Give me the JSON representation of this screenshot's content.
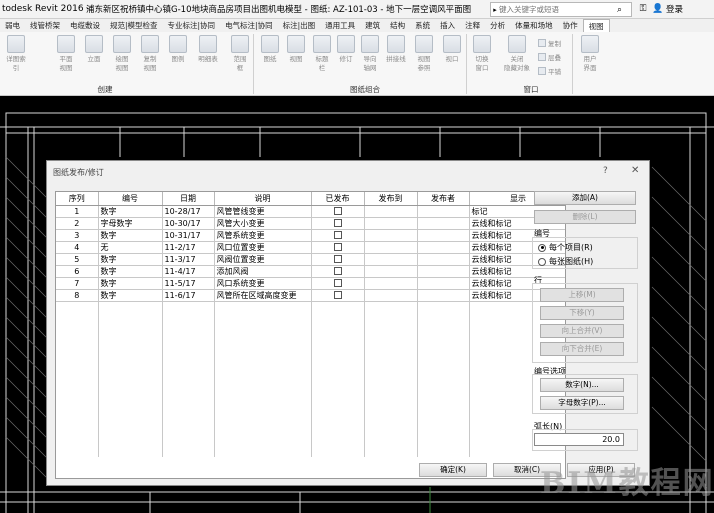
{
  "titlebar": {
    "app_name": "todesk Revit 2016 -",
    "document": "浦东新区祝桥镇中心镇G-10地块商品房项目出图机电模型 - 图纸: AZ-101-03 - 地下一层空调风平面图",
    "search_placeholder": "键入关键字或短语",
    "login_label": "登录"
  },
  "ribbon_tabs": [
    {
      "label": "弱电",
      "active": false
    },
    {
      "label": "线管桥架",
      "active": false
    },
    {
      "label": "电缆敷设",
      "active": false
    },
    {
      "label": "规范|模型检查",
      "active": false
    },
    {
      "label": "专业标注|协同",
      "active": false
    },
    {
      "label": "电气标注|协同",
      "active": false
    },
    {
      "label": "标注|出图",
      "active": false
    },
    {
      "label": "通用工具",
      "active": false
    },
    {
      "label": "建筑",
      "active": false
    },
    {
      "label": "结构",
      "active": false
    },
    {
      "label": "系统",
      "active": false
    },
    {
      "label": "插入",
      "active": false
    },
    {
      "label": "注释",
      "active": false
    },
    {
      "label": "分析",
      "active": false
    },
    {
      "label": "体量和场地",
      "active": false
    },
    {
      "label": "协作",
      "active": false
    },
    {
      "label": "视图",
      "active": true
    }
  ],
  "ribbon": {
    "panel_create": "创建",
    "panel_sheet": "图纸组合",
    "panel_window": "窗口",
    "buttons": [
      "详图索引",
      "平面\n视图",
      "立面",
      "绘图\n视图",
      "复制\n视图",
      "图例",
      "明细表",
      "范围\n框",
      "图纸",
      "视图",
      "标题\n栏",
      "修订",
      "导向\n轴网",
      "拼接线",
      "视图\n参照",
      "视口",
      "切换\n窗口",
      "关闭\n隐藏对象",
      "用户\n界面"
    ],
    "small_buttons": [
      "复制",
      "层叠",
      "平铺"
    ]
  },
  "dialog": {
    "title": "图纸发布/修订",
    "help": "?",
    "close": "✕",
    "columns": [
      "序列",
      "编号",
      "日期",
      "说明",
      "已发布",
      "发布到",
      "发布者",
      "显示"
    ],
    "rows": [
      {
        "seq": "1",
        "num": "数字",
        "date": "10-28/17",
        "desc": "风管管线变更",
        "issued": false,
        "to": "",
        "by": "",
        "show": "标记"
      },
      {
        "seq": "2",
        "num": "字母数字",
        "date": "10-30/17",
        "desc": "风管大小变更",
        "issued": false,
        "to": "",
        "by": "",
        "show": "云线和标记"
      },
      {
        "seq": "3",
        "num": "数字",
        "date": "10-31/17",
        "desc": "风管系统变更",
        "issued": false,
        "to": "",
        "by": "",
        "show": "云线和标记"
      },
      {
        "seq": "4",
        "num": "无",
        "date": "11-2/17",
        "desc": "风口位置变更",
        "issued": false,
        "to": "",
        "by": "",
        "show": "云线和标记"
      },
      {
        "seq": "5",
        "num": "数字",
        "date": "11-3/17",
        "desc": "风阀位置变更",
        "issued": false,
        "to": "",
        "by": "",
        "show": "云线和标记"
      },
      {
        "seq": "6",
        "num": "数字",
        "date": "11-4/17",
        "desc": "添加风阀",
        "issued": false,
        "to": "",
        "by": "",
        "show": "云线和标记"
      },
      {
        "seq": "7",
        "num": "数字",
        "date": "11-5/17",
        "desc": "风口系统变更",
        "issued": false,
        "to": "",
        "by": "",
        "show": "云线和标记"
      },
      {
        "seq": "8",
        "num": "数字",
        "date": "11-6/17",
        "desc": "风管所在区域高度变更",
        "issued": false,
        "to": "",
        "by": "",
        "show": "云线和标记"
      }
    ],
    "add_button": "添加(A)",
    "delete_button": "删除(L)",
    "numbering_group": "编号",
    "radio_per_project": "每个项目(R)",
    "radio_per_sheet": "每张图纸(H)",
    "row_group": "行",
    "move_up": "上移(M)",
    "move_down": "下移(Y)",
    "merge_up": "向上合并(V)",
    "merge_down": "向下合并(E)",
    "numbering_options": "编号选项",
    "numeric_button": "数字(N)...",
    "alphanumeric_button": "字母数字(P)...",
    "arc_length_label": "弧长(N)",
    "arc_length_value": "20.0",
    "ok_button": "确定(K)",
    "cancel_button": "取消(C)",
    "apply_button": "应用(P)"
  },
  "watermark": "BIM教程网"
}
